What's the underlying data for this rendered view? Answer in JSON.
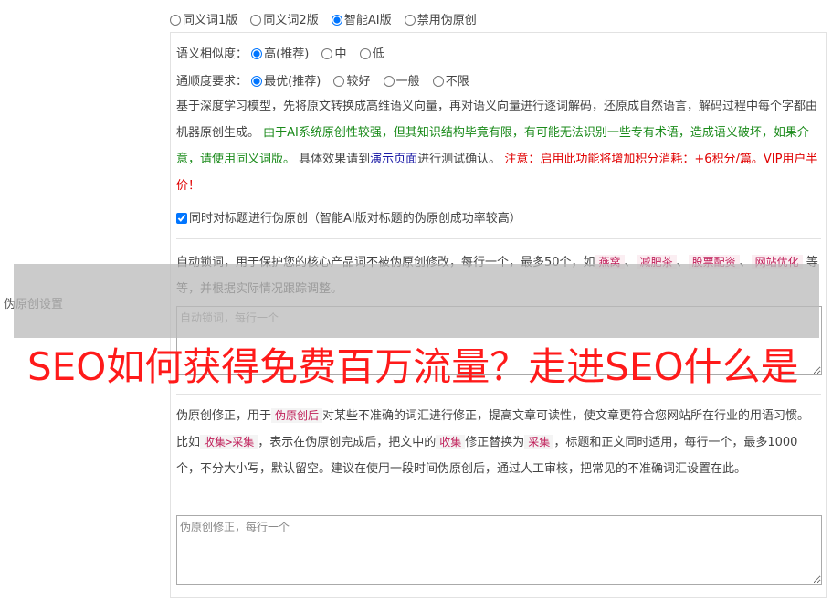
{
  "mode": {
    "options": [
      "同义词1版",
      "同义词2版",
      "智能AI版",
      "禁用伪原创"
    ],
    "selected": 2
  },
  "settings_label": "伪原创设置",
  "similarity": {
    "label": "语义相似度：",
    "options": [
      "高(推荐)",
      "中",
      "低"
    ],
    "selected": 0
  },
  "fluency": {
    "label": "通顺度要求：",
    "options": [
      "最优(推荐)",
      "较好",
      "一般",
      "不限"
    ],
    "selected": 0
  },
  "description": {
    "p1": "基于深度学习模型，先将原文转换成高维语义向量，再对语义向量进行逐词解码，还原成自然语言，解码过程中每个字都由机器原创生成。",
    "p2_green": " 由于AI系统原创性较强，但其知识结构毕竟有限，有可能无法识别一些专有术语，造成语义破坏，如果介意，请使用同义词版。",
    "p3": " 具体效果请到",
    "link": "演示页面",
    "p4": "进行测试确认。",
    "p5_red": " 注意：启用此功能将增加积分消耗：+6积分/篇。VIP用户半价！"
  },
  "title_checkbox": {
    "label": "同时对标题进行伪原创（智能AI版对标题的伪原创成功率较高）",
    "checked": true
  },
  "lock_words": {
    "text1": "自动锁词，用于保护您的核心产品词不被伪原创修改，每行一个，最多50个，如",
    "examples": [
      "燕窝",
      "减肥茶",
      "股票配资",
      "网站优化"
    ],
    "sep": "、",
    "text2": "等等，并根据实际情况跟踪调整。",
    "placeholder": "自动锁词，每行一个"
  },
  "correction": {
    "text1": "伪原创修正，用于",
    "tag1": "伪原创后",
    "text2": "对某些不准确的词汇进行修正，提高文章可读性，使文章更符合您网站所在行业的用语习惯。比如",
    "tag2": "收集>采集",
    "text3": "，表示在伪原创完成后，把文中的",
    "tag3": "收集",
    "text4": "修正替换为",
    "tag4": "采集",
    "text5": "，标题和正文同时适用，每行一个，最多1000个，不分大小写，默认留空。建议在使用一段时间伪原创后，通过人工审核，把常见的不准确词汇设置在此。",
    "placeholder": "伪原创修正，每行一个"
  },
  "watermark": "SEO如何获得免费百万流量？走进SEO什么是"
}
